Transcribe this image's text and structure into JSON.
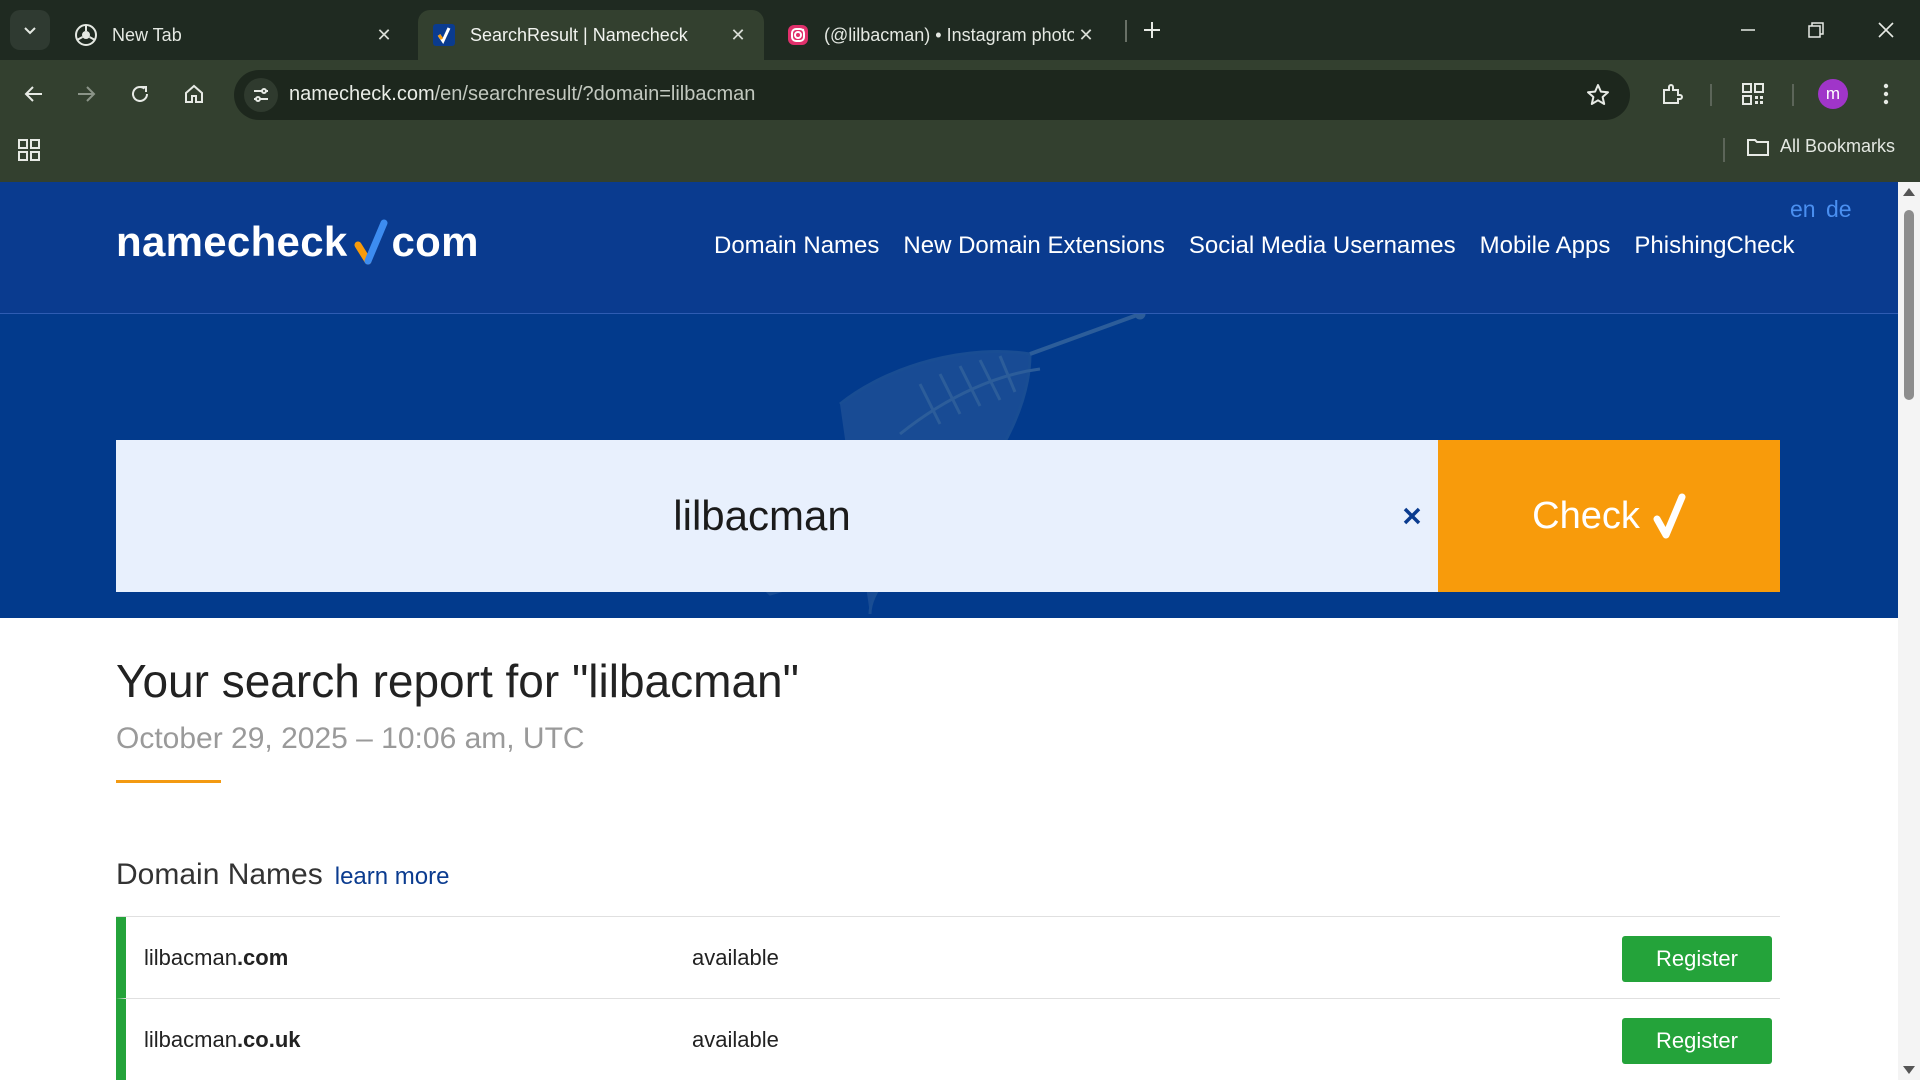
{
  "browser": {
    "tabs": [
      {
        "title": "New Tab",
        "active": false
      },
      {
        "title": "SearchResult | Namecheck",
        "active": true
      },
      {
        "title": "(@lilbacman) • Instagram photo",
        "active": false
      }
    ],
    "url_host": "namecheck.com",
    "url_path": "/en/searchresult/?domain=lilbacman",
    "profile_initial": "m",
    "bookmarks_label": "All Bookmarks"
  },
  "site": {
    "logo_left": "namecheck",
    "logo_right": "com",
    "nav": [
      "Domain Names",
      "New Domain Extensions",
      "Social Media Usernames",
      "Mobile Apps",
      "PhishingCheck"
    ],
    "lang_en": "en",
    "lang_de": "de"
  },
  "search": {
    "value": "lilbacman",
    "button_label": "Check"
  },
  "report": {
    "title": "Your search report for \"lilbacman\"",
    "date": "October 29, 2025 – 10:06 am, UTC"
  },
  "domains": {
    "title": "Domain Names",
    "learn_more": "learn more",
    "rows": [
      {
        "name": "lilbacman",
        "tld": ".com",
        "status": "available",
        "action": "Register"
      },
      {
        "name": "lilbacman",
        "tld": ".co.uk",
        "status": "available",
        "action": "Register"
      }
    ]
  },
  "colors": {
    "header_bg": "#0a3b8f",
    "accent_orange": "#f89b0b",
    "available_green": "#24a33a"
  }
}
